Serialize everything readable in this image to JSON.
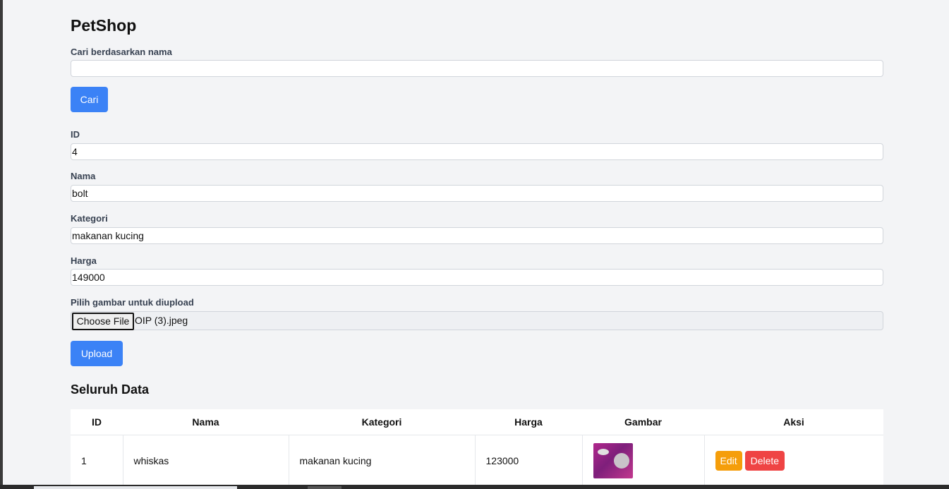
{
  "app": {
    "title": "PetShop"
  },
  "search": {
    "label": "Cari berdasarkan nama",
    "value": "",
    "button_label": "Cari"
  },
  "form": {
    "id_label": "ID",
    "id_value": "4",
    "nama_label": "Nama",
    "nama_value": "bolt",
    "kategori_label": "Kategori",
    "kategori_value": "makanan kucing",
    "harga_label": "Harga",
    "harga_value": "149000",
    "file_label": "Pilih gambar untuk diupload",
    "file_button_label": "Choose File",
    "file_name": "OIP (3).jpeg",
    "upload_label": "Upload"
  },
  "table": {
    "title": "Seluruh Data",
    "headers": [
      "ID",
      "Nama",
      "Kategori",
      "Harga",
      "Gambar",
      "Aksi"
    ],
    "rows": [
      {
        "id": "1",
        "nama": "whiskas",
        "kategori": "makanan kucing",
        "harga": "123000",
        "gambar_icon": "product-image",
        "edit_label": "Edit",
        "delete_label": "Delete"
      }
    ]
  },
  "colors": {
    "primary": "#3b82f6",
    "edit": "#f59e0b",
    "delete": "#ef4444",
    "background": "#f3f4f6"
  }
}
